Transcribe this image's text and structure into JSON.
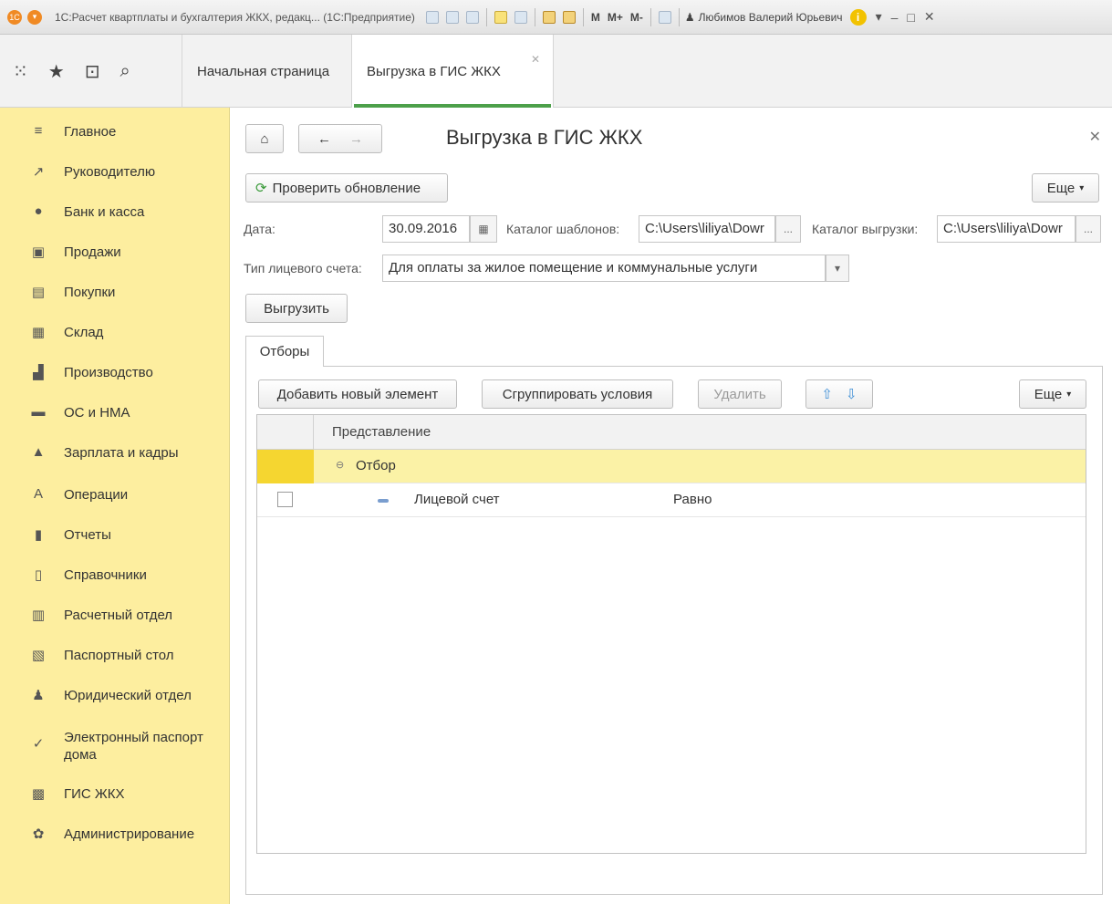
{
  "window": {
    "title": "1С:Расчет квартплаты и бухгалтерия ЖКХ, редакц... (1С:Предприятие)",
    "m_buttons": [
      "M",
      "M+",
      "M-"
    ],
    "user": "Любимов Валерий Юрьевич"
  },
  "tabs": [
    {
      "label": "Начальная страница"
    },
    {
      "label": "Выгрузка в ГИС ЖКХ"
    }
  ],
  "sidebar": {
    "items": [
      {
        "label": "Главное",
        "icon": "≡"
      },
      {
        "label": "Руководителю",
        "icon": "↗"
      },
      {
        "label": "Банк и касса",
        "icon": "●"
      },
      {
        "label": "Продажи",
        "icon": "▣"
      },
      {
        "label": "Покупки",
        "icon": "▤"
      },
      {
        "label": "Склад",
        "icon": "▦"
      },
      {
        "label": "Производство",
        "icon": "▟"
      },
      {
        "label": "ОС и НМА",
        "icon": "▬"
      },
      {
        "label": "Зарплата и кадры",
        "icon": "▲"
      },
      {
        "label": "Операции",
        "icon": "A"
      },
      {
        "label": "Отчеты",
        "icon": "▮"
      },
      {
        "label": "Справочники",
        "icon": "▯"
      },
      {
        "label": "Расчетный отдел",
        "icon": "▥"
      },
      {
        "label": "Паспортный стол",
        "icon": "▧"
      },
      {
        "label": "Юридический отдел",
        "icon": "♟"
      },
      {
        "label": "Электронный паспорт",
        "label2": "дома",
        "icon": "✓"
      },
      {
        "label": "ГИС ЖКХ",
        "icon": "▩"
      },
      {
        "label": "Администрирование",
        "icon": "✿"
      }
    ]
  },
  "form": {
    "title": "Выгрузка в ГИС ЖКХ",
    "check_update": "Проверить обновление",
    "more": "Еще",
    "date_label": "Дата:",
    "date_value": "30.09.2016",
    "templates_label": "Каталог шаблонов:",
    "templates_value": "C:\\Users\\liliya\\Dowr",
    "export_dir_label": "Каталог выгрузки:",
    "export_dir_value": "C:\\Users\\liliya\\Dowr",
    "account_type_label": "Тип лицевого счета:",
    "account_type_value": "Для оплаты за жилое помещение и коммунальные услуги",
    "export_button": "Выгрузить",
    "ellipsis": "..."
  },
  "filters": {
    "tab_label": "Отборы",
    "add_button": "Добавить новый элемент",
    "group_button": "Сгруппировать условия",
    "delete_button": "Удалить",
    "more": "Еще",
    "column_header": "Представление",
    "rows": [
      {
        "text": "Отбор",
        "group": true
      },
      {
        "text": "Лицевой счет",
        "condition": "Равно"
      }
    ]
  }
}
